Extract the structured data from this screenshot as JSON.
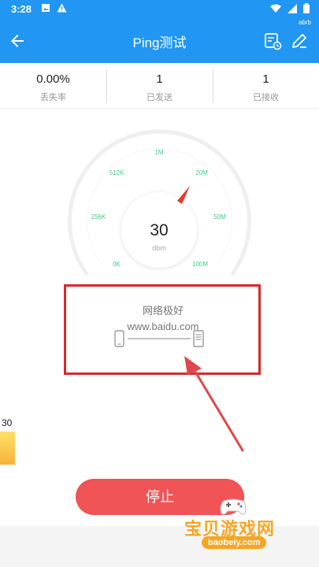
{
  "status_bar": {
    "time": "3:28"
  },
  "app_bar": {
    "title": "Ping测试",
    "badge": "abrb"
  },
  "stats": [
    {
      "value": "0.00%",
      "label": "丢失率"
    },
    {
      "value": "1",
      "label": "已发送"
    },
    {
      "value": "1",
      "label": "已接收"
    }
  ],
  "gauge": {
    "value": "30",
    "unit": "dbm",
    "scale_labels": [
      "0K",
      "256K",
      "512K",
      "1M",
      "20M",
      "50M",
      "100M"
    ],
    "label_color": "#3ccf8e",
    "needle_color": "#e8392b"
  },
  "result": {
    "status": "网络极好",
    "host": "www.baidu.com"
  },
  "side_level": {
    "value": "30"
  },
  "stop_button": {
    "label": "停止"
  },
  "watermark": {
    "title": "宝贝游戏网",
    "url": "baobeiy.com"
  },
  "colors": {
    "primary": "#2196f3",
    "stop": "#f05456",
    "highlight": "#d8282b"
  }
}
